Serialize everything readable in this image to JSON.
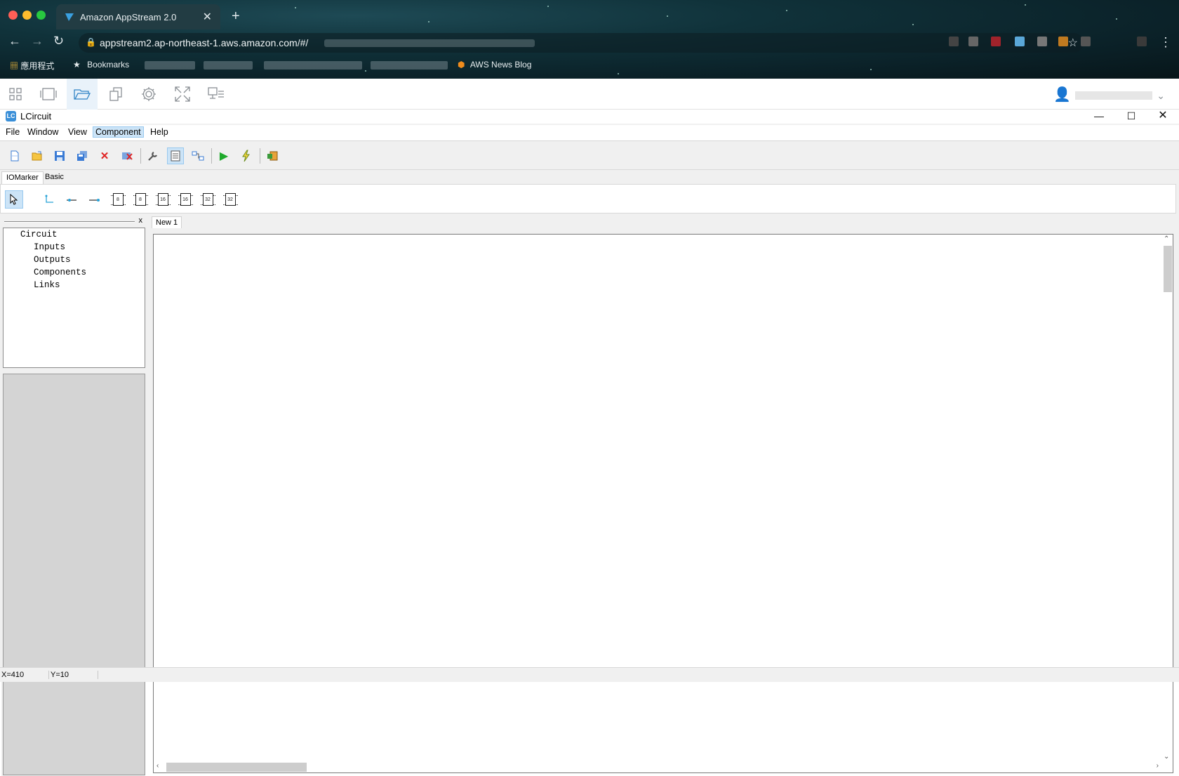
{
  "browser": {
    "tab_title": "Amazon AppStream 2.0",
    "url": "appstream2.ap-northeast-1.aws.amazon.com/#/",
    "bookmarks": {
      "apps": "應用程式",
      "bookmarks": "Bookmarks",
      "aws_news": "AWS News Blog"
    }
  },
  "appstream": {
    "toolbar_icons": [
      "app-launcher",
      "windows",
      "folder",
      "clipboard",
      "settings",
      "fullscreen",
      "display"
    ]
  },
  "app": {
    "title": "LCircuit",
    "menu": [
      "File",
      "Window",
      "View",
      "Component",
      "Help"
    ],
    "palette_tabs": [
      "IOMarker",
      "Basic"
    ],
    "palette_chips": [
      "8",
      "8",
      "16",
      "16",
      "32",
      "32"
    ],
    "tree": {
      "root": "Circuit",
      "children": [
        "Inputs",
        "Outputs",
        "Components",
        "Links"
      ]
    },
    "panel_close": "x",
    "document_tab": "New 1",
    "status": {
      "x": "X=410",
      "y": "Y=10"
    }
  },
  "colors": {
    "selection_bg": "#cce4f7",
    "selection_border": "#99c9ef",
    "appstream_active": "#2f83c5"
  }
}
